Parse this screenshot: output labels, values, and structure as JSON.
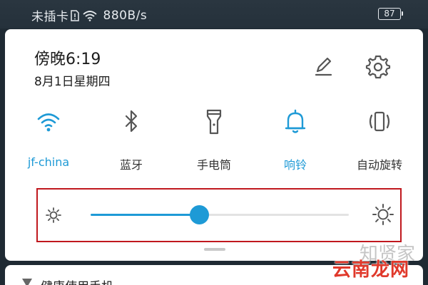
{
  "status_bar": {
    "sim_text": "未插卡",
    "net_speed": "880B/s",
    "battery": "87"
  },
  "header": {
    "time": "傍晚6:19",
    "date": "8月1日星期四"
  },
  "toggles": [
    {
      "label": "jf-china",
      "icon": "wifi-icon",
      "active": true
    },
    {
      "label": "蓝牙",
      "icon": "bluetooth-icon",
      "active": false
    },
    {
      "label": "手电筒",
      "icon": "flashlight-icon",
      "active": false
    },
    {
      "label": "响铃",
      "icon": "bell-icon",
      "active": true
    },
    {
      "label": "自动旋转",
      "icon": "auto-rotate-icon",
      "active": false
    }
  ],
  "brightness": {
    "level": 0.42
  },
  "notification": {
    "title": "健康使用手机"
  },
  "watermark": {
    "back_text": "知贤家",
    "main_text": "云南龙网"
  },
  "colors": {
    "accent": "#1e9ad6",
    "highlight_box": "#c0181e",
    "icon_gray": "#555555"
  }
}
